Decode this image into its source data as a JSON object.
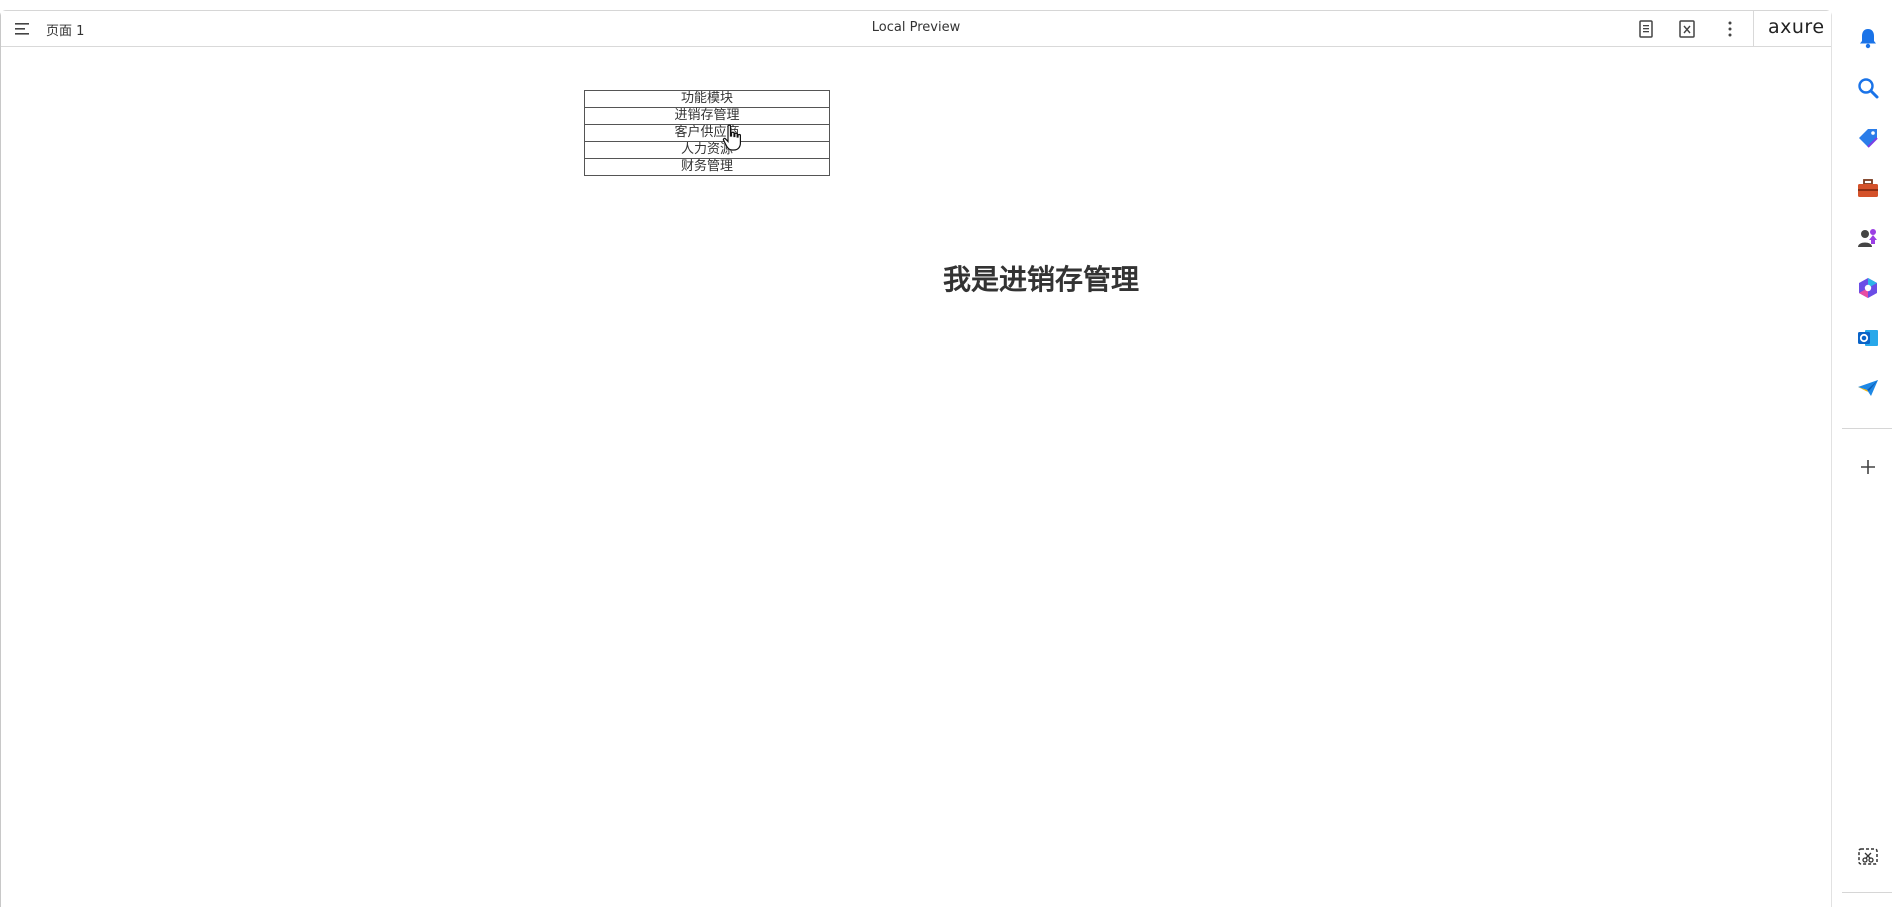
{
  "toolbar": {
    "page_label": "页面 1",
    "center_title": "Local Preview",
    "logo_text": "axure"
  },
  "nav": {
    "items": [
      {
        "label": "功能模块"
      },
      {
        "label": "进销存管理"
      },
      {
        "label": "客户供应商"
      },
      {
        "label": "人力资源"
      },
      {
        "label": "财务管理"
      }
    ]
  },
  "main": {
    "heading": "我是进销存管理"
  },
  "sidebar": {
    "icons": [
      "bell-icon",
      "search-icon",
      "tag-icon",
      "toolbox-icon",
      "people-icon",
      "copilot-icon",
      "outlook-icon",
      "send-icon",
      "add-icon",
      "screenshot-icon"
    ]
  },
  "colors": {
    "border": "#555555",
    "text": "#333333",
    "bell": "#1a73e8",
    "search": "#1a73e8",
    "tag": "#2b7de9",
    "toolbox": "#d4522a",
    "outlook": "#0a64c8",
    "send": "#1e88e5"
  }
}
